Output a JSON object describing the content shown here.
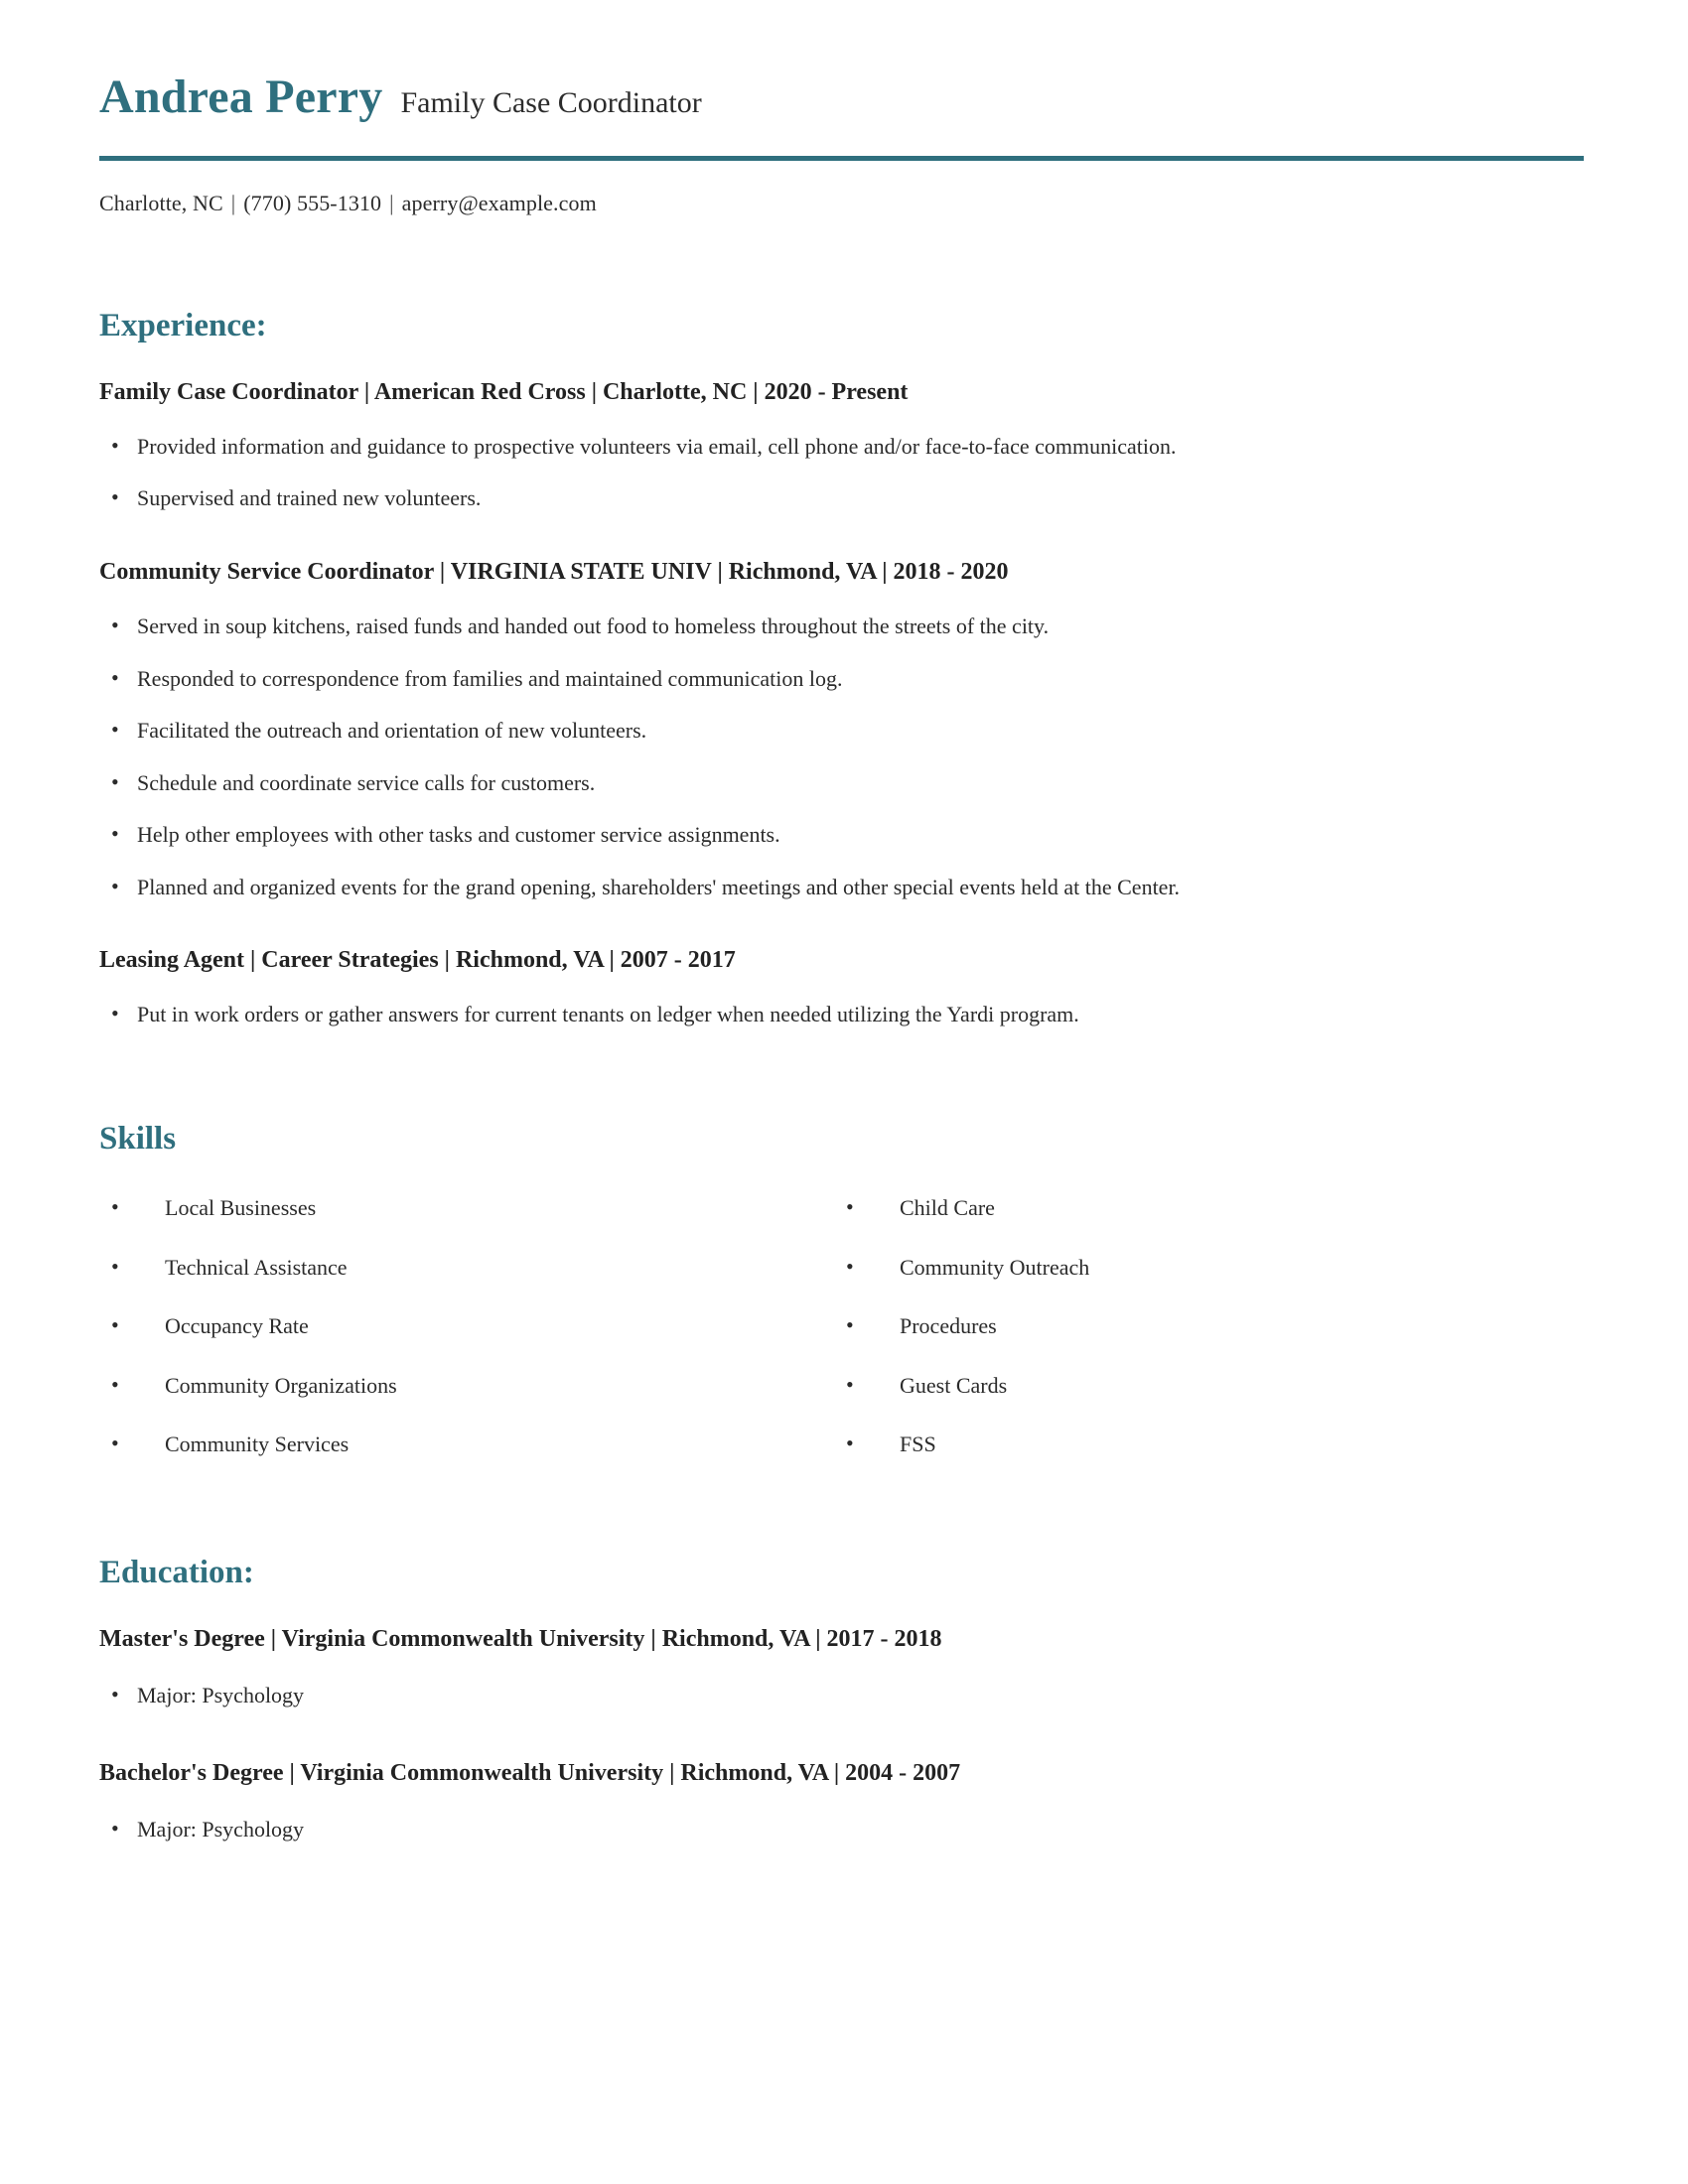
{
  "header": {
    "name": "Andrea Perry",
    "job_title": "Family Case Coordinator",
    "separator": "|",
    "contact": {
      "location": "Charlotte, NC",
      "phone": "(770) 555-1310",
      "email": "aperry@example.com"
    }
  },
  "theme": {
    "accent_color": "#2f6f7e",
    "text_color": "#2b2b2b",
    "background_color": "#ffffff"
  },
  "experience": {
    "title": "Experience:",
    "entries": [
      {
        "heading": "Family Case Coordinator | American Red Cross | Charlotte, NC |  2020 - Present",
        "bullets": [
          "Provided information and guidance to prospective volunteers via email, cell phone and/or face-to-face communication.",
          "Supervised and trained new volunteers."
        ]
      },
      {
        "heading": "Community Service Coordinator | VIRGINIA STATE UNIV | Richmond, VA | 2018 - 2020",
        "bullets": [
          "Served in soup kitchens, raised funds and handed out food to homeless throughout the streets of the city.",
          "Responded to correspondence from families and maintained communication log.",
          "Facilitated the outreach and orientation of new volunteers.",
          "Schedule and coordinate service calls for customers.",
          "Help other employees with other tasks and customer service assignments.",
          "Planned and organized events for the grand opening, shareholders' meetings and other special events held at the Center."
        ]
      },
      {
        "heading": "Leasing Agent | Career Strategies | Richmond, VA | 2007 - 2017",
        "bullets": [
          "Put in work orders or gather answers for current tenants on ledger when needed utilizing the Yardi program."
        ]
      }
    ]
  },
  "skills": {
    "title": "Skills",
    "left_column": [
      "Local Businesses",
      "Technical Assistance",
      "Occupancy Rate",
      "Community Organizations",
      "Community Services"
    ],
    "right_column": [
      "Child Care",
      "Community Outreach",
      "Procedures",
      "Guest Cards",
      "FSS"
    ]
  },
  "education": {
    "title": "Education:",
    "entries": [
      {
        "heading": "Master's Degree | Virginia Commonwealth University | Richmond, VA | 2017 - 2018",
        "bullets": [
          "Major: Psychology"
        ]
      },
      {
        "heading": "Bachelor's Degree | Virginia Commonwealth University | Richmond, VA | 2004 - 2007",
        "bullets": [
          "Major: Psychology"
        ]
      }
    ]
  }
}
